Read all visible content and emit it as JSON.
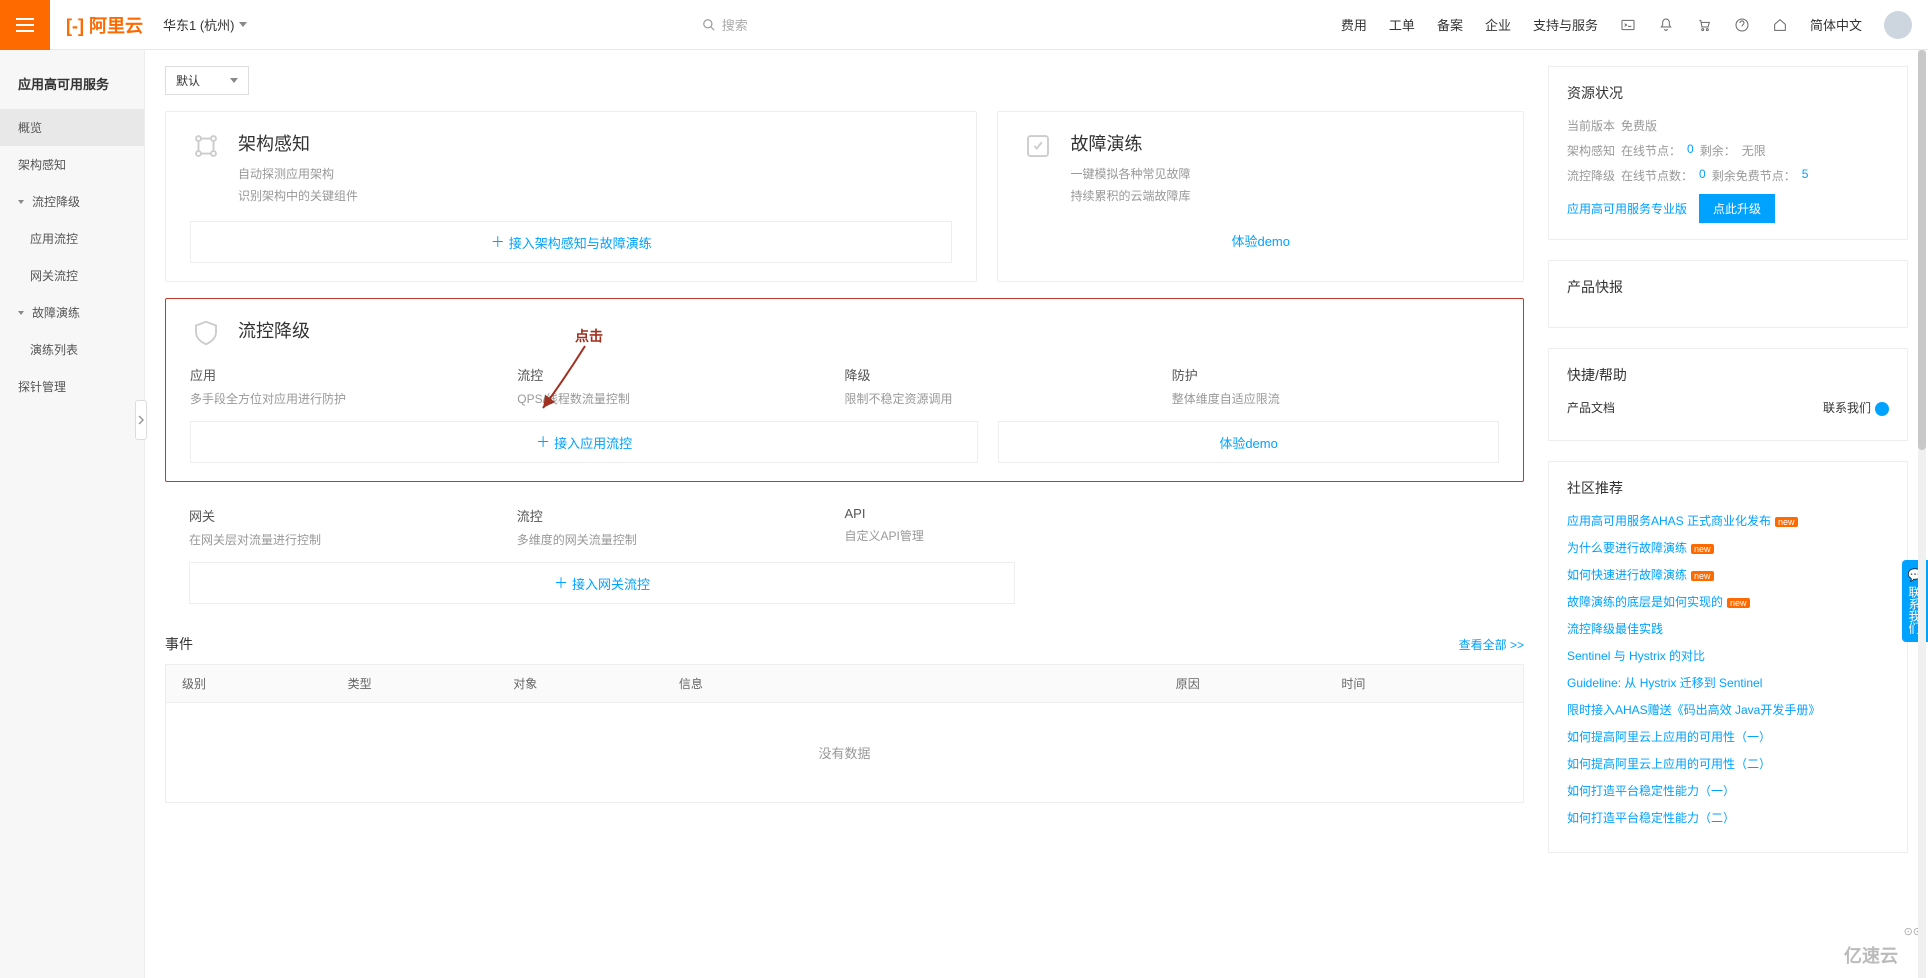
{
  "topbar": {
    "logo": "[-] 阿里云",
    "region": "华东1 (杭州)",
    "search_placeholder": "搜索",
    "nav": [
      "费用",
      "工单",
      "备案",
      "企业",
      "支持与服务"
    ],
    "lang": "简体中文"
  },
  "sidebar": {
    "title": "应用高可用服务",
    "items": [
      {
        "label": "概览",
        "indent": false,
        "active": true
      },
      {
        "label": "架构感知",
        "indent": false
      },
      {
        "label": "流控降级",
        "indent": false,
        "group": true
      },
      {
        "label": "应用流控",
        "indent": true
      },
      {
        "label": "网关流控",
        "indent": true
      },
      {
        "label": "故障演练",
        "indent": false,
        "group": true
      },
      {
        "label": "演练列表",
        "indent": true
      },
      {
        "label": "探针管理",
        "indent": false
      }
    ]
  },
  "selector": {
    "label": "默认"
  },
  "annotation": "点击",
  "cards": {
    "arch": {
      "title": "架构感知",
      "subs": [
        "自动探测应用架构",
        "识别架构中的关键组件"
      ],
      "action": "接入架构感知与故障演练"
    },
    "fault": {
      "title": "故障演练",
      "subs": [
        "一键模拟各种常见故障",
        "持续累积的云端故障库"
      ],
      "action": "体验demo"
    },
    "flow": {
      "title": "流控降级",
      "cols": [
        {
          "title": "应用",
          "desc": "多手段全方位对应用进行防护"
        },
        {
          "title": "流控",
          "desc": "QPS/线程数流量控制"
        },
        {
          "title": "降级",
          "desc": "限制不稳定资源调用"
        },
        {
          "title": "防护",
          "desc": "整体维度自适应限流"
        }
      ],
      "action_primary": "接入应用流控",
      "action_demo": "体验demo"
    },
    "gateway": {
      "cols": [
        {
          "title": "网关",
          "desc": "在网关层对流量进行控制"
        },
        {
          "title": "流控",
          "desc": "多维度的网关流量控制"
        },
        {
          "title": "API",
          "desc": "自定义API管理"
        }
      ],
      "action": "接入网关流控"
    }
  },
  "events": {
    "title": "事件",
    "view_all": "查看全部 >>",
    "headers": [
      "级别",
      "类型",
      "对象",
      "信息",
      "原因",
      "时间"
    ],
    "empty": "没有数据"
  },
  "side": {
    "resource": {
      "title": "资源状况",
      "version_label": "当前版本",
      "version": "免费版",
      "arch_label": "架构感知",
      "arch_online_label": "在线节点：",
      "arch_online": "0",
      "arch_remain_label": "剩余：",
      "arch_remain": "无限",
      "flow_label": "流控降级",
      "flow_online_label": "在线节点数：",
      "flow_online": "0",
      "flow_remain_label": "剩余免费节点：",
      "flow_remain": "5",
      "pro_link": "应用高可用服务专业版",
      "upgrade_btn": "点此升级"
    },
    "express": {
      "title": "产品快报"
    },
    "help": {
      "title": "快捷/帮助",
      "doc_label": "产品文档",
      "contact": "联系我们"
    },
    "community": {
      "title": "社区推荐",
      "links": [
        {
          "text": "应用高可用服务AHAS 正式商业化发布",
          "new": true
        },
        {
          "text": "为什么要进行故障演练",
          "new": true
        },
        {
          "text": "如何快速进行故障演练",
          "new": true
        },
        {
          "text": "故障演练的底层是如何实现的",
          "new": true
        },
        {
          "text": "流控降级最佳实践",
          "new": false
        },
        {
          "text": "Sentinel 与 Hystrix 的对比",
          "new": false
        },
        {
          "text": "Guideline: 从 Hystrix 迁移到 Sentinel",
          "new": false
        },
        {
          "text": "限时接入AHAS赠送《码出高效 Java开发手册》",
          "new": false
        },
        {
          "text": "如何提高阿里云上应用的可用性（一）",
          "new": false
        },
        {
          "text": "如何提高阿里云上应用的可用性（二）",
          "new": false
        },
        {
          "text": "如何打造平台稳定性能力（一）",
          "new": false
        },
        {
          "text": "如何打造平台稳定性能力（二）",
          "new": false
        }
      ]
    }
  },
  "float_contact": "联系我们",
  "watermark": "亿速云",
  "badge_new_text": "new"
}
